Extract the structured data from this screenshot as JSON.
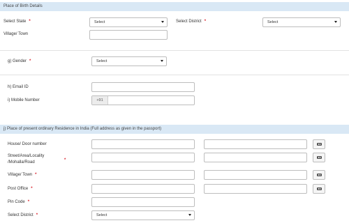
{
  "birth": {
    "header": "Place of Birth Details",
    "state_label": "Select State",
    "state_value": "Select",
    "district_label": "Select District",
    "district_value": "Select",
    "village_label": "Village/ Town"
  },
  "gender": {
    "label": "g) Gender",
    "value": "Select"
  },
  "contact": {
    "email_label": "h) Email ID",
    "mobile_label": "i) Mobile Number",
    "mobile_prefix": "+91"
  },
  "residence": {
    "header": "j) Place of present ordinary Residence in India (Full address as given in the passport)",
    "house_label": "House/ Door number",
    "street_label": "Street/Area/Locality /Mohalla/Road",
    "village_label": "Village/ Town",
    "post_office_label": "Post Office",
    "pin_label": "Pin Code",
    "district_label": "Select District",
    "district_value": "Select"
  },
  "required_mark": "*",
  "colors": {
    "header_bg": "#d9e8f5",
    "required": "#d9232d",
    "border": "#bdbdbd"
  },
  "icons": {
    "dropdown": "chevron-down-icon",
    "keyboard": "keyboard-icon"
  }
}
